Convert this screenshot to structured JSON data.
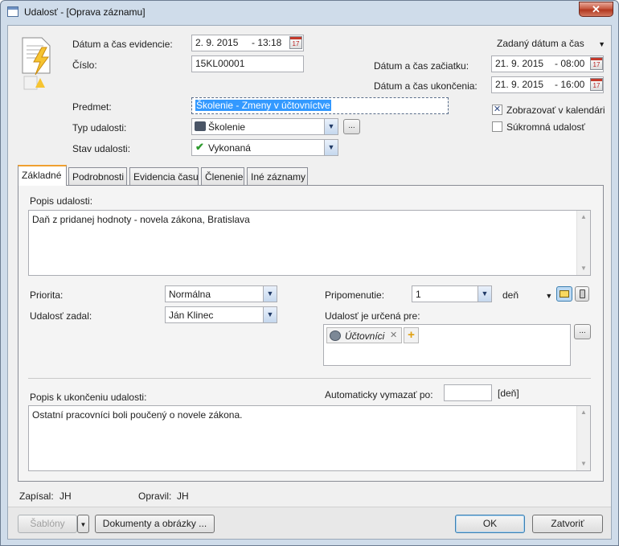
{
  "window": {
    "title": "Udalosť - [Oprava záznamu]",
    "close_label": "✕"
  },
  "header": {
    "datum_evidencie_label": "Dátum a čas evidencie:",
    "datum_evidencie_date": "2. 9. 2015",
    "datum_evidencie_time": "- 13:18",
    "cislo_label": "Číslo:",
    "cislo_value": "15KL00001",
    "zadany_label": "Zadaný dátum a čas",
    "zaciatok_label": "Dátum a čas začiatku:",
    "zaciatok_date": "21. 9. 2015",
    "zaciatok_time": "- 08:00",
    "ukoncenie_label": "Dátum a čas ukončenia:",
    "ukoncenie_date": "21. 9. 2015",
    "ukoncenie_time": "- 16:00",
    "predmet_label": "Predmet:",
    "predmet_value": "Školenie - Zmeny v účtovníctve",
    "typ_label": "Typ udalosti:",
    "typ_value": "Školenie",
    "stav_label": "Stav udalosti:",
    "stav_value": "Vykonaná",
    "zobrazovat_label": "Zobrazovať v kalendári",
    "zobrazovat_checked": true,
    "sukromna_label": "Súkromná udalosť",
    "sukromna_checked": false,
    "ellipsis": "..."
  },
  "tabs": [
    {
      "label": "Základné",
      "active": true
    },
    {
      "label": "Podrobnosti",
      "active": false
    },
    {
      "label": "Evidencia času",
      "active": false
    },
    {
      "label": "Členenie",
      "active": false
    },
    {
      "label": "Iné záznamy",
      "active": false
    }
  ],
  "basic": {
    "popis_label": "Popis udalosti:",
    "popis_value": "Daň z pridanej hodnoty - novela zákona, Bratislava",
    "priorita_label": "Priorita:",
    "priorita_value": "Normálna",
    "zadal_label": "Udalosť zadal:",
    "zadal_value": "Ján Klinec",
    "pripomenutie_label": "Pripomenutie:",
    "pripomenutie_value": "1",
    "pripomenutie_unit": "deň",
    "urcena_label": "Udalosť je určená pre:",
    "urcena_item": "Účtovníci",
    "automaticky_label": "Automaticky vymazať po:",
    "automaticky_value": "",
    "automaticky_unit": "[deň]",
    "ukoncenie_popis_label": "Popis k ukončeniu udalosti:",
    "ukoncenie_popis_value": "Ostatní pracovníci boli poučený o novele zákona."
  },
  "footer": {
    "zapisal_label": "Zapísal:",
    "zapisal_value": "JH",
    "opravil_label": "Opravil:",
    "opravil_value": "JH",
    "sablony_label": "Šablóny",
    "dokumenty_label": "Dokumenty a obrázky ...",
    "ok_label": "OK",
    "zatvorit_label": "Zatvoriť"
  },
  "colors": {
    "accent": "#f0a030",
    "selection": "#3399ff",
    "check_green": "#2e9a2e"
  }
}
